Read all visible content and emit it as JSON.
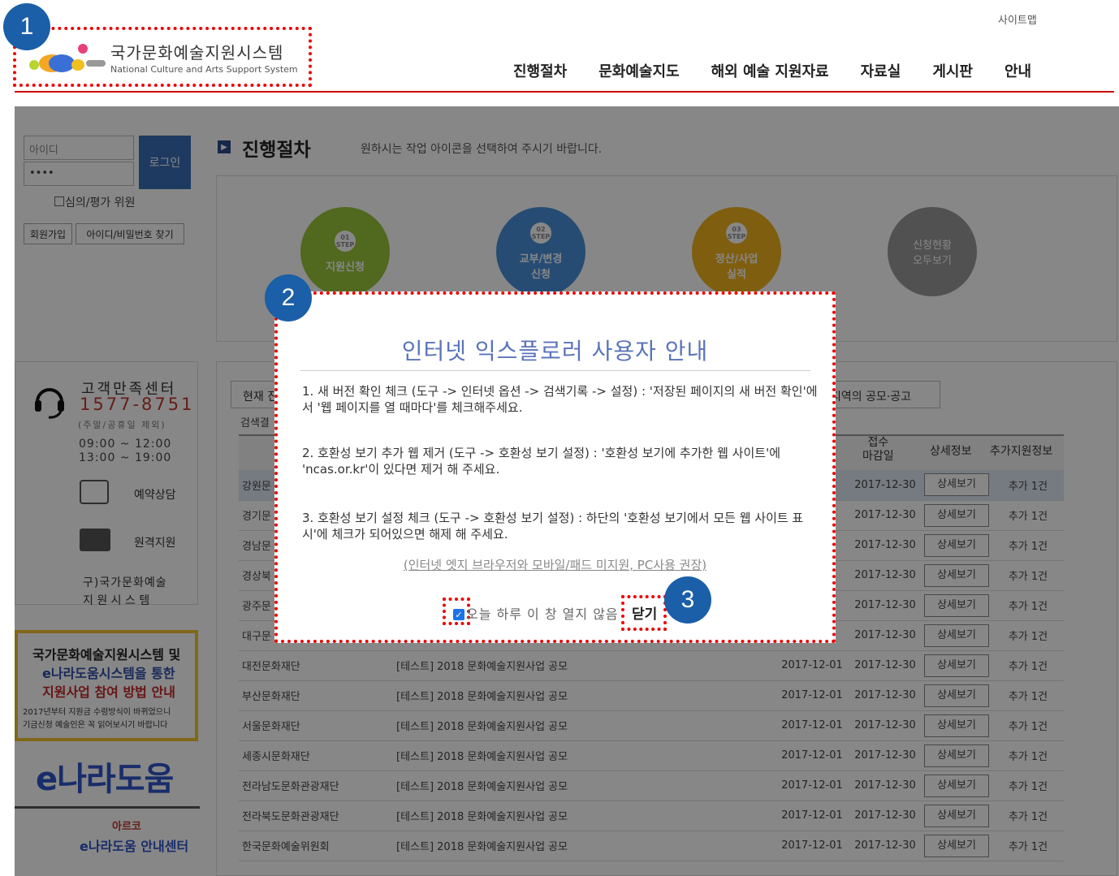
{
  "header": {
    "sitemap": "사이트맵",
    "logo_kr": "국가문화예술지원시스템",
    "logo_en": "National Culture and Arts Support System",
    "nav": [
      "진행절차",
      "문화예술지도",
      "해외 예술 지원자료",
      "자료실",
      "게시판",
      "안내"
    ]
  },
  "sidebar": {
    "id_placeholder": "아이디",
    "pw_value": "••••",
    "login": "로그인",
    "reviewer": "심의/평가 위원",
    "join": "회원가입",
    "find": "아이디/비밀번호 찾기",
    "cs_title": "고객만족센터",
    "cs_phone": "1577-8751",
    "cs_note": "(주말/공휴일 제외)",
    "cs_hours1": "09:00 ~ 12:00",
    "cs_hours2": "13:00 ~ 19:00",
    "reserve": "예약상담",
    "remote": "원격지원",
    "old_sys_1": "구)국가문화예술",
    "old_sys_2": "지 원 시 스 템",
    "banner1_l1": "국가문화예술지원시스템 및",
    "banner1_l2": "e나라도움시스템을 통한",
    "banner1_l3": "지원사업 참여 방법 안내",
    "banner1_l4": "2017년부터 지원금 수령방식이 바뀌었으니",
    "banner1_l5": "기금신청 예술인은 꼭 읽어보시기 바랍니다",
    "enara": "e나라도움",
    "arko_l1": "아르코",
    "arko_l2": "e나라도움 안내센터"
  },
  "main": {
    "title": "진행절차",
    "subtitle": "원하시는 작업 아이콘을 선택하여 주시기 바랍니다.",
    "steps": [
      {
        "num": "01",
        "step": "STEP",
        "label": "지원신청"
      },
      {
        "num": "02",
        "step": "STEP",
        "label": "교부/변경\n신청"
      },
      {
        "num": "03",
        "step": "STEP",
        "label": "정산/사업\n실적"
      }
    ],
    "all_view": "신청현황\n오두보기",
    "tab_current": "현재 진",
    "tab_regional": "지역의 공모·공고",
    "search_result": "검색결",
    "col_deadline": "접수\n마감일",
    "col_detail": "상세정보",
    "col_extra": "추가지원정보",
    "rows": [
      {
        "org": "강원문",
        "title": "",
        "start": "",
        "end": "2017-12-30",
        "detail": "상세보기",
        "extra": "추가 1건"
      },
      {
        "org": "경기문",
        "title": "",
        "start": "",
        "end": "2017-12-30",
        "detail": "상세보기",
        "extra": "추가 1건"
      },
      {
        "org": "경남문",
        "title": "",
        "start": "",
        "end": "2017-12-30",
        "detail": "상세보기",
        "extra": "추가 1건"
      },
      {
        "org": "경상북",
        "title": "",
        "start": "",
        "end": "2017-12-30",
        "detail": "상세보기",
        "extra": "추가 1건"
      },
      {
        "org": "광주문",
        "title": "",
        "start": "",
        "end": "2017-12-30",
        "detail": "상세보기",
        "extra": "추가 1건"
      },
      {
        "org": "대구문",
        "title": "",
        "start": "",
        "end": "2017-12-30",
        "detail": "상세보기",
        "extra": "추가 1건"
      },
      {
        "org": "대전문화재단",
        "title": "[테스트] 2018 문화예술지원사업 공모",
        "start": "2017-12-01",
        "end": "2017-12-30",
        "detail": "상세보기",
        "extra": "추가 1건"
      },
      {
        "org": "부산문화재단",
        "title": "[테스트] 2018 문화예술지원사업 공모",
        "start": "2017-12-01",
        "end": "2017-12-30",
        "detail": "상세보기",
        "extra": "추가 1건"
      },
      {
        "org": "서울문화재단",
        "title": "[테스트] 2018 문화예술지원사업 공모",
        "start": "2017-12-01",
        "end": "2017-12-30",
        "detail": "상세보기",
        "extra": "추가 1건"
      },
      {
        "org": "세종시문화재단",
        "title": "[테스트] 2018 문화예술지원사업 공모",
        "start": "2017-12-01",
        "end": "2017-12-30",
        "detail": "상세보기",
        "extra": "추가 1건"
      },
      {
        "org": "전라남도문화관광재단",
        "title": "[테스트] 2018 문화예술지원사업 공모",
        "start": "2017-12-01",
        "end": "2017-12-30",
        "detail": "상세보기",
        "extra": "추가 1건"
      },
      {
        "org": "전라북도문화관광재단",
        "title": "[테스트] 2018 문화예술지원사업 공모",
        "start": "2017-12-01",
        "end": "2017-12-30",
        "detail": "상세보기",
        "extra": "추가 1건"
      },
      {
        "org": "한국문화예술위원회",
        "title": "[테스트] 2018 문화예술지원사업 공모",
        "start": "2017-12-01",
        "end": "2017-12-30",
        "detail": "상세보기",
        "extra": "추가 1건"
      }
    ]
  },
  "modal": {
    "title": "인터넷 익스플로러 사용자 안내",
    "item1": "1. 새 버전 확인 체크 (도구 -> 인터넷 옵션 -> 검색기록 -> 설정) : '저장된 페이지의 새 버전 확인'에서 '웹 페이지를 열 때마다'를 체크해주세요.",
    "item2": "2. 호환성 보기 추가 웹 제거 (도구 -> 호환성 보기 설정) : '호환성 보기에 추가한 웹 사이트'에 'ncas.or.kr'이 있다면 제거 해 주세요.",
    "item3": "3. 호환성 보기 설정 체크 (도구 -> 호환성 보기 설정) : 하단의 '호환성 보기에서 모든 웹 사이트 표시'에 체크가 되어있으면 해제 해 주세요.",
    "link": "(인터넷 엣지 브라우저와 모바일/패드 미지원, PC사용 권장)",
    "dont_show": "오늘 하루 이 창 열지 않음",
    "close": "닫기"
  },
  "callouts": [
    "1",
    "2",
    "3"
  ],
  "colors": {
    "accent_red": "#cc0000",
    "callout_blue": "#1a5fa8",
    "modal_title": "#5a74b8"
  }
}
